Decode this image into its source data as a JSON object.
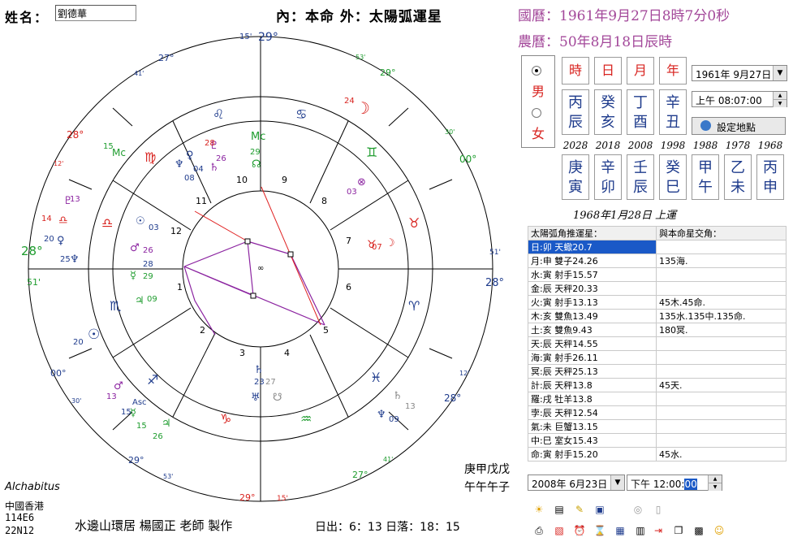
{
  "header": {
    "name_label": "姓名：",
    "name_value": "劉德華",
    "chart_title": "內：本命 外：太陽弧運星",
    "solar_date": "國曆：1961年9月27日8時7分0秒",
    "lunar_date": "農曆：50年8月18日辰時"
  },
  "gender": {
    "male": "男",
    "female": "女",
    "selected": "male"
  },
  "pillars": {
    "headers": [
      "時",
      "日",
      "月",
      "年"
    ],
    "stems": [
      "丙",
      "癸",
      "丁",
      "辛"
    ],
    "branches": [
      "辰",
      "亥",
      "酉",
      "丑"
    ]
  },
  "birth_controls": {
    "date_value": "1961年  9月27日",
    "time_value": "上午 08:07:00",
    "set_place_label": "設定地點"
  },
  "luck": {
    "years": [
      "2028",
      "2018",
      "2008",
      "1998",
      "1988",
      "1978",
      "1968"
    ],
    "stems": [
      "庚",
      "辛",
      "壬",
      "癸",
      "甲",
      "乙",
      "丙"
    ],
    "branches": [
      "寅",
      "卯",
      "辰",
      "巳",
      "午",
      "未",
      "申"
    ],
    "start_note": "1968年1月28日 上運"
  },
  "aspect_table": {
    "col1_header": "太陽弧角推運星：",
    "col2_header": "與本命星交角：",
    "rows": [
      [
        "日:卯 天蠍20.7",
        ""
      ],
      [
        "月:申 雙子24.26",
        "135海."
      ],
      [
        "水:寅 射手15.57",
        ""
      ],
      [
        "金:辰 天秤20.33",
        ""
      ],
      [
        "火:寅 射手13.13",
        "45木.45命."
      ],
      [
        "木:亥 雙魚13.49",
        "135水.135中.135命."
      ],
      [
        "土:亥 雙魚9.43",
        "180冥."
      ],
      [
        "天:辰 天秤14.55",
        ""
      ],
      [
        "海:寅 射手26.11",
        ""
      ],
      [
        "冥:辰 天秤25.13",
        ""
      ],
      [
        "計:辰 天秤13.8",
        "45天."
      ],
      [
        "羅:戌 牡羊13.8",
        ""
      ],
      [
        "孛:辰 天秤12.54",
        ""
      ],
      [
        "氣:未 巨蟹13.15",
        ""
      ],
      [
        "中:巳 室女15.43",
        ""
      ],
      [
        "命:寅 射手15.20",
        "45水."
      ]
    ]
  },
  "footer": {
    "system": "Alchabitus",
    "place": "中國香港",
    "longitude": "114E6",
    "latitude": "22N12",
    "credit": "水邊山環居 楊國正 老師 製作",
    "sunrise": "日出：6：13 日落：18：15",
    "bazi_line1": "庚甲戊戊",
    "bazi_line2": "午午午子",
    "progress_date": "2008年  6月23日",
    "progress_time_prefix": "下午 12:00:",
    "progress_time_selected": "00"
  },
  "wheel_labels": {
    "mc_top_deg": "29°",
    "mc_top_min": "15'",
    "ic_bottom_deg": "29°",
    "ic_bottom_min": "15'",
    "asc_deg": "28°",
    "asc_min": "51'",
    "desc_deg": "28°",
    "desc_min": "51'",
    "cusps_outer": [
      {
        "deg": "27°",
        "min": "41'"
      },
      {
        "deg": "28°",
        "min": "12'"
      },
      {
        "deg": "00°",
        "min": "30'"
      },
      {
        "deg": "29°",
        "min": "53'"
      },
      {
        "deg": "27°",
        "min": "41'"
      },
      {
        "deg": "28°",
        "min": "12'"
      },
      {
        "deg": "00°",
        "min": "30'"
      },
      {
        "deg": "29°",
        "min": "53'"
      }
    ],
    "houses": [
      "1",
      "2",
      "3",
      "4",
      "5",
      "6",
      "7",
      "8",
      "9",
      "10",
      "11",
      "12"
    ]
  },
  "icons": {
    "toolbar_row1": [
      "sun-settings-icon",
      "page-icon",
      "pencil-icon",
      "window-icon",
      "cd-icon",
      "document-icon"
    ],
    "toolbar_row2": [
      "print-icon",
      "save-icon",
      "alarm-icon",
      "hourglass-icon",
      "calendar-icon",
      "calculator-icon",
      "export-icon",
      "copy-icon",
      "print-preview-icon",
      "help-icon"
    ]
  },
  "colors": {
    "title_purple": "#a3489a",
    "pillar_blue": "#1e3b8c",
    "header_red": "#d8231f",
    "selection_blue": "#1a59c7"
  }
}
